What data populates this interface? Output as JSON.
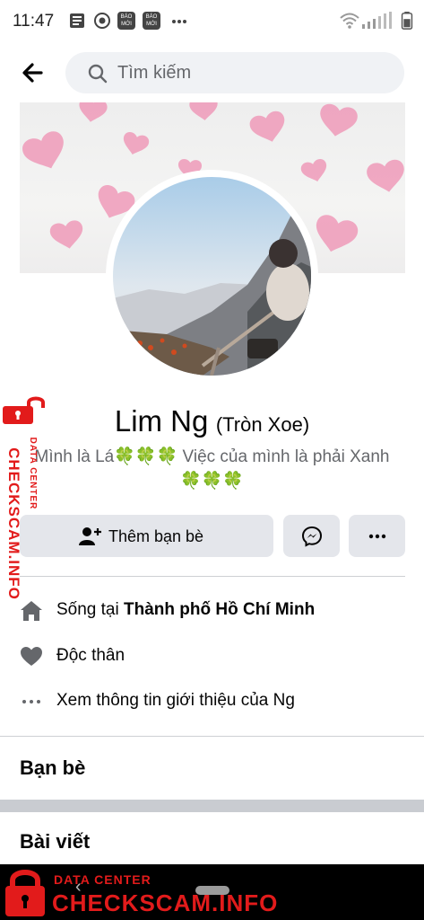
{
  "status_bar": {
    "time": "11:47",
    "notif_icons": [
      "news-icon",
      "messenger-icon",
      "bao-moi-icon",
      "bao-moi-icon",
      "more-dots-icon"
    ],
    "badge_text": "BÁO MỚI",
    "right_icons": [
      "wifi-icon",
      "signal-icon",
      "battery-icon"
    ]
  },
  "header": {
    "search_placeholder": "Tìm kiếm"
  },
  "profile": {
    "name": "Lim Ng",
    "alternate_name": "(Tròn Xoe)",
    "bio_part1": "Mình là Lá",
    "bio_clovers1": "🍀🍀🍀",
    "bio_part2": " Việc của mình là phải Xanh",
    "bio_clovers2": "🍀🍀🍀"
  },
  "actions": {
    "add_friend_label": "Thêm bạn bè"
  },
  "intro": {
    "lives_prefix": "Sống tại ",
    "lives_city": "Thành phố Hồ Chí Minh",
    "relationship": "Độc thân",
    "see_about": "Xem thông tin giới thiệu của Ng"
  },
  "sections": {
    "friends": "Bạn bè",
    "posts": "Bài viết"
  },
  "watermark": {
    "small": "DATA CENTER",
    "big": "CHECKSCAM.INFO"
  },
  "colors": {
    "button_bg": "#e4e6eb",
    "search_bg": "#f0f2f5",
    "watermark_red": "#e21b1b",
    "heart_pink": "#f08fb0"
  }
}
